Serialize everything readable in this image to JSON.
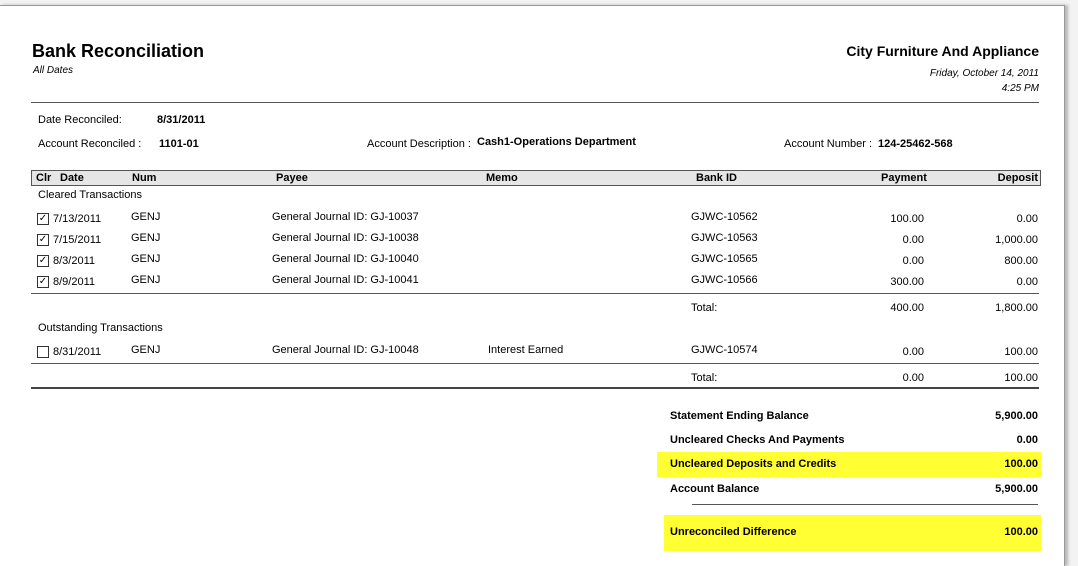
{
  "header": {
    "title": "Bank Reconciliation",
    "subtitle": "All Dates",
    "company": "City Furniture And Appliance",
    "date": "Friday, October 14, 2011",
    "time": "4:25 PM"
  },
  "info": {
    "date_reconciled_label": "Date Reconciled:",
    "date_reconciled": "8/31/2011",
    "account_reconciled_label": "Account Reconciled :",
    "account_reconciled": "1101-01",
    "account_description_label": "Account Description :",
    "account_description": "Cash1-Operations Department",
    "account_number_label": "Account Number :",
    "account_number": "124-25462-568"
  },
  "columns": {
    "clr": "Clr",
    "date": "Date",
    "num": "Num",
    "payee": "Payee",
    "memo": "Memo",
    "bank_id": "Bank ID",
    "payment": "Payment",
    "deposit": "Deposit"
  },
  "cleared": {
    "heading": "Cleared Transactions",
    "rows": [
      {
        "checked": true,
        "date": "7/13/2011",
        "num": "GENJ",
        "payee": "General Journal ID: GJ-10037",
        "memo": "",
        "bank_id": "GJWC-10562",
        "payment": "100.00",
        "deposit": "0.00"
      },
      {
        "checked": true,
        "date": "7/15/2011",
        "num": "GENJ",
        "payee": "General Journal ID: GJ-10038",
        "memo": "",
        "bank_id": "GJWC-10563",
        "payment": "0.00",
        "deposit": "1,000.00"
      },
      {
        "checked": true,
        "date": "8/3/2011",
        "num": "GENJ",
        "payee": "General Journal ID: GJ-10040",
        "memo": "",
        "bank_id": "GJWC-10565",
        "payment": "0.00",
        "deposit": "800.00"
      },
      {
        "checked": true,
        "date": "8/9/2011",
        "num": "GENJ",
        "payee": "General Journal ID: GJ-10041",
        "memo": "",
        "bank_id": "GJWC-10566",
        "payment": "300.00",
        "deposit": "0.00"
      }
    ],
    "total_label": "Total:",
    "total_payment": "400.00",
    "total_deposit": "1,800.00"
  },
  "outstanding": {
    "heading": "Outstanding Transactions",
    "rows": [
      {
        "checked": false,
        "date": "8/31/2011",
        "num": "GENJ",
        "payee": "General Journal ID: GJ-10048",
        "memo": "Interest Earned",
        "bank_id": "GJWC-10574",
        "payment": "0.00",
        "deposit": "100.00"
      }
    ],
    "total_label": "Total:",
    "total_payment": "0.00",
    "total_deposit": "100.00"
  },
  "summary": {
    "statement_ending_balance_label": "Statement Ending Balance",
    "statement_ending_balance": "5,900.00",
    "uncleared_checks_label": "Uncleared Checks And Payments",
    "uncleared_checks": "0.00",
    "uncleared_deposits_label": "Uncleared Deposits and Credits",
    "uncleared_deposits": "100.00",
    "account_balance_label": "Account Balance",
    "account_balance": "5,900.00",
    "unreconciled_difference_label": "Unreconciled Difference",
    "unreconciled_difference": "100.00"
  },
  "colors": {
    "highlight": "#ffff33",
    "header_bg": "#e6e6e6"
  }
}
